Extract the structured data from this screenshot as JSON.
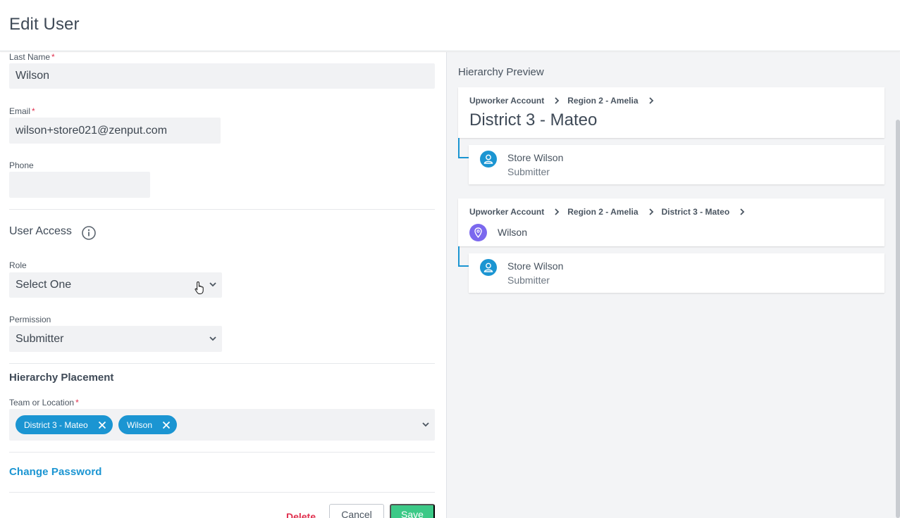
{
  "header": {
    "title": "Edit User"
  },
  "form": {
    "last_name": {
      "label": "Last Name",
      "required_mark": "*",
      "value": "Wilson"
    },
    "email": {
      "label": "Email",
      "required_mark": "*",
      "value": "wilson+store021@zenput.com"
    },
    "phone": {
      "label": "Phone",
      "value": ""
    },
    "user_access": {
      "title": "User Access",
      "icon": "info-icon"
    },
    "role": {
      "label": "Role",
      "value": "Select One"
    },
    "permission": {
      "label": "Permission",
      "value": "Submitter"
    },
    "hierarchy_placement": {
      "title": "Hierarchy Placement"
    },
    "team_or_location": {
      "label": "Team or Location",
      "required_mark": "*",
      "tags": [
        {
          "label": "District 3 - Mateo"
        },
        {
          "label": "Wilson"
        }
      ]
    },
    "change_password": "Change Password",
    "actions": {
      "delete": "Delete",
      "cancel": "Cancel",
      "save": "Save"
    }
  },
  "preview": {
    "title": "Hierarchy Preview",
    "cards": [
      {
        "breadcrumb": [
          "Upworker Account",
          "Region 2 - Amelia"
        ],
        "name": "District 3 - Mateo",
        "user": {
          "name": "Store Wilson",
          "role": "Submitter"
        }
      },
      {
        "breadcrumb": [
          "Upworker Account",
          "Region 2 - Amelia",
          "District 3 - Mateo"
        ],
        "name": "Wilson",
        "icon": "location-pin-icon",
        "user": {
          "name": "Store Wilson",
          "role": "Submitter"
        }
      }
    ]
  },
  "colors": {
    "accent": "#1b95d2",
    "danger": "#e0304e",
    "success": "#3cc987",
    "location": "#7b68ee"
  }
}
